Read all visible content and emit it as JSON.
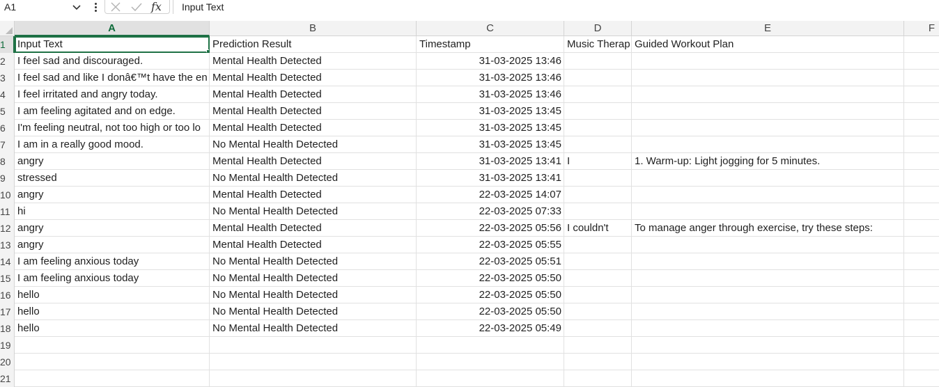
{
  "formula_bar": {
    "name_box": "A1",
    "fx_label": "fx",
    "content": "Input Text"
  },
  "columns": [
    "A",
    "B",
    "C",
    "D",
    "E",
    "F"
  ],
  "row_numbers": [
    "1",
    "2",
    "3",
    "4",
    "5",
    "6",
    "7",
    "8",
    "9",
    "10",
    "11",
    "12",
    "13",
    "14",
    "15",
    "16",
    "17",
    "18",
    "19",
    "20",
    "21"
  ],
  "rows": [
    [
      "Input Text",
      "Prediction Result",
      "Timestamp",
      "Music Therap",
      "Guided Workout Plan"
    ],
    [
      "I feel sad and discouraged.",
      "Mental Health Detected",
      "31-03-2025 13:46",
      "",
      ""
    ],
    [
      "I feel sad and like I donâ€™t have the en",
      "Mental Health Detected",
      "31-03-2025 13:46",
      "",
      ""
    ],
    [
      "I feel irritated and angry today.",
      "Mental Health Detected",
      "31-03-2025 13:46",
      "",
      ""
    ],
    [
      "I am feeling agitated and on edge.",
      "Mental Health Detected",
      "31-03-2025 13:45",
      "",
      ""
    ],
    [
      "I'm feeling neutral, not too high or too lo",
      "Mental Health Detected",
      "31-03-2025 13:45",
      "",
      ""
    ],
    [
      "I am in a really good mood.",
      "No Mental Health Detected",
      "31-03-2025 13:45",
      "",
      ""
    ],
    [
      "angry",
      "Mental Health Detected",
      "31-03-2025 13:41",
      "I",
      "1. Warm-up: Light jogging for 5 minutes."
    ],
    [
      "stressed",
      "No Mental Health Detected",
      "31-03-2025 13:41",
      "",
      ""
    ],
    [
      "angry",
      "Mental Health Detected",
      "22-03-2025 14:07",
      "",
      ""
    ],
    [
      "hi",
      "No Mental Health Detected",
      "22-03-2025 07:33",
      "",
      ""
    ],
    [
      "angry",
      "Mental Health Detected",
      "22-03-2025 05:56",
      "I couldn't",
      "To manage anger through exercise, try these steps:"
    ],
    [
      "angry",
      "Mental Health Detected",
      "22-03-2025 05:55",
      "",
      ""
    ],
    [
      "I am feeling anxious today",
      "No Mental Health Detected",
      "22-03-2025 05:51",
      "",
      ""
    ],
    [
      "I am feeling anxious today",
      "No Mental Health Detected",
      "22-03-2025 05:50",
      "",
      ""
    ],
    [
      "hello",
      "No Mental Health Detected",
      "22-03-2025 05:50",
      "",
      ""
    ],
    [
      "hello",
      "No Mental Health Detected",
      "22-03-2025 05:50",
      "",
      ""
    ],
    [
      "hello",
      "No Mental Health Detected",
      "22-03-2025 05:49",
      "",
      ""
    ],
    [
      "",
      "",
      "",
      "",
      ""
    ],
    [
      "",
      "",
      "",
      "",
      ""
    ],
    [
      "",
      "",
      "",
      "",
      ""
    ]
  ],
  "colors": {
    "selection_green": "#1e7145",
    "header_bg": "#f3f3f3",
    "gridline": "#e1e1e1"
  }
}
